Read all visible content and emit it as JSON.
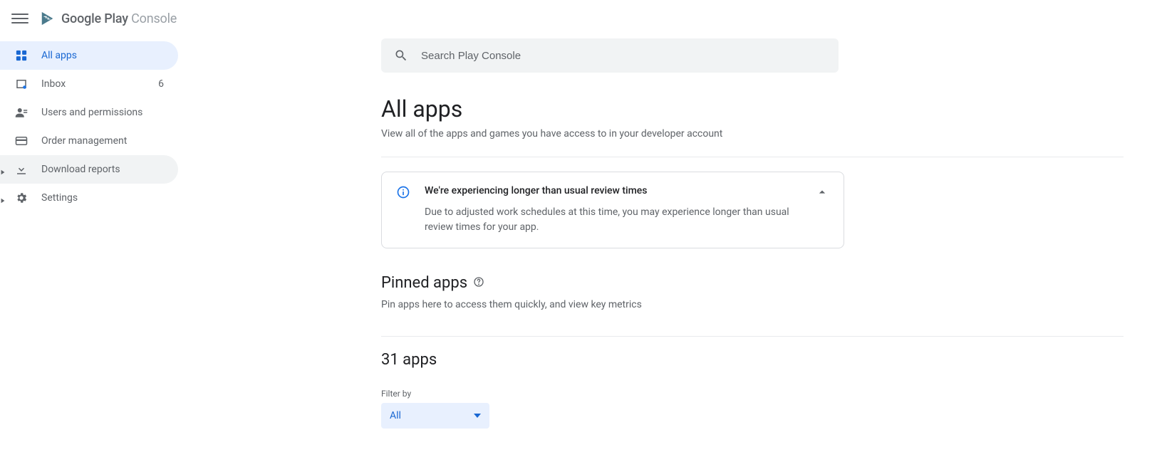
{
  "brand": {
    "bold": "Google Play",
    "light": " Console"
  },
  "search": {
    "placeholder": "Search Play Console"
  },
  "sidebar": {
    "items": [
      {
        "label": "All apps"
      },
      {
        "label": "Inbox",
        "badge": "6"
      },
      {
        "label": "Users and permissions"
      },
      {
        "label": "Order management"
      },
      {
        "label": "Download reports"
      },
      {
        "label": "Settings"
      }
    ]
  },
  "main": {
    "title": "All apps",
    "subtitle": "View all of the apps and games you have access to in your developer account"
  },
  "notice": {
    "title": "We're experiencing longer than usual review times",
    "body": "Due to adjusted work schedules at this time, you may experience longer than usual review times for your app."
  },
  "pinned": {
    "heading": "Pinned apps",
    "sub": "Pin apps here to access them quickly, and view key metrics"
  },
  "appcount": {
    "heading": "31 apps"
  },
  "filter": {
    "label": "Filter by",
    "value": "All"
  }
}
